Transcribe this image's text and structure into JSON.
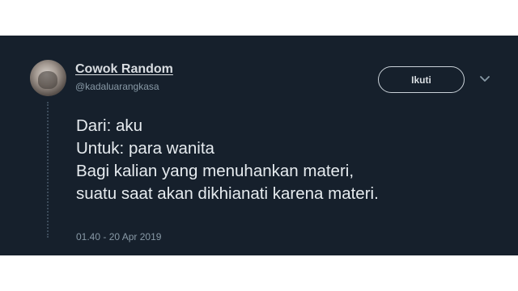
{
  "tweet": {
    "display_name": "Cowok Random",
    "handle": "@kadaluarangkasa",
    "follow_label": "Ikuti",
    "lines": [
      "Dari: aku",
      "Untuk: para wanita",
      "Bagi kalian yang menuhankan materi,",
      "suatu saat akan dikhianati karena materi."
    ],
    "timestamp": "01.40 - 20 Apr 2019"
  },
  "icons": {
    "menu": "chevron-down-icon"
  },
  "colors": {
    "background": "#16202c",
    "primary_text": "#e6ebef",
    "secondary_text": "#8899a6"
  }
}
